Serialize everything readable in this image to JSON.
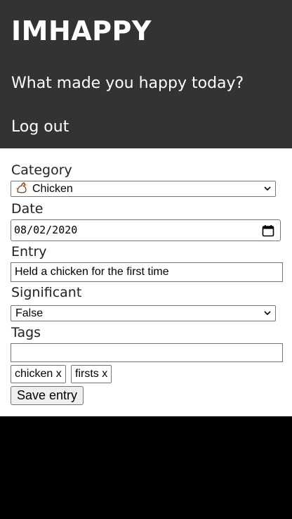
{
  "header": {
    "brand": "IMHAPPY",
    "nav": {
      "happy": "What made you happy today?",
      "logout": "Log out"
    }
  },
  "form": {
    "category": {
      "label": "Category",
      "value": "Chicken",
      "icon": "chicken-icon"
    },
    "date": {
      "label": "Date",
      "value": "08/02/2020"
    },
    "entry": {
      "label": "Entry",
      "value": "Held a chicken for the first time"
    },
    "significant": {
      "label": "Significant",
      "value": "False"
    },
    "tags": {
      "label": "Tags",
      "input_value": "",
      "items": [
        {
          "label": "chicken x"
        },
        {
          "label": "firsts x"
        }
      ]
    },
    "save_label": "Save entry"
  },
  "colors": {
    "header_bg": "#333333",
    "page_bg": "#000000",
    "form_bg": "#ffffff"
  }
}
